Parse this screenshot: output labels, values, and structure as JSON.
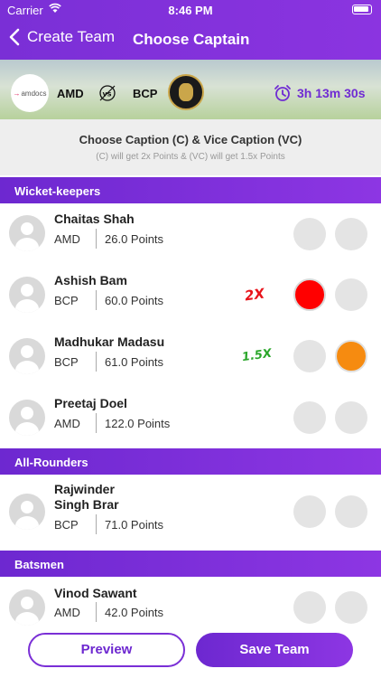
{
  "status_bar": {
    "carrier": "Carrier",
    "time": "8:46 PM"
  },
  "nav": {
    "back_label": "Create Team",
    "title": "Choose Captain"
  },
  "match": {
    "team_a": "AMD",
    "team_a_logo_text": "amdocs",
    "team_b": "BCP",
    "timer": "3h 13m 30s"
  },
  "instructions": {
    "main": "Choose Caption (C)  & Vice Caption (VC)",
    "sub": "(C) will get 2x Points & (VC) will get 1.5x Points"
  },
  "multipliers": {
    "captain": "2X",
    "vice_captain": "1.5X"
  },
  "sections": {
    "wicket_keepers": "Wicket-keepers",
    "all_rounders": "All-Rounders",
    "batsmen": "Batsmen"
  },
  "players": [
    {
      "name": "Chaitas Shah",
      "team": "AMD",
      "points": "26.0  Points",
      "captain": false,
      "vice_captain": false
    },
    {
      "name": "Ashish Bam",
      "team": "BCP",
      "points": "60.0  Points",
      "captain": true,
      "vice_captain": false
    },
    {
      "name": "Madhukar Madasu",
      "team": "BCP",
      "points": "61.0  Points",
      "captain": false,
      "vice_captain": true
    },
    {
      "name": "Preetaj Doel",
      "team": "AMD",
      "points": "122.0  Points",
      "captain": false,
      "vice_captain": false
    },
    {
      "name": "Rajwinder Singh Brar",
      "team": "BCP",
      "points": "71.0  Points",
      "captain": false,
      "vice_captain": false
    },
    {
      "name": "Vinod Sawant",
      "team": "AMD",
      "points": "42.0  Points",
      "captain": false,
      "vice_captain": false
    }
  ],
  "buttons": {
    "preview": "Preview",
    "save": "Save Team"
  },
  "colors": {
    "primary": "#7a2fd6",
    "captain": "#ff0000",
    "vice_captain": "#f68b10"
  }
}
